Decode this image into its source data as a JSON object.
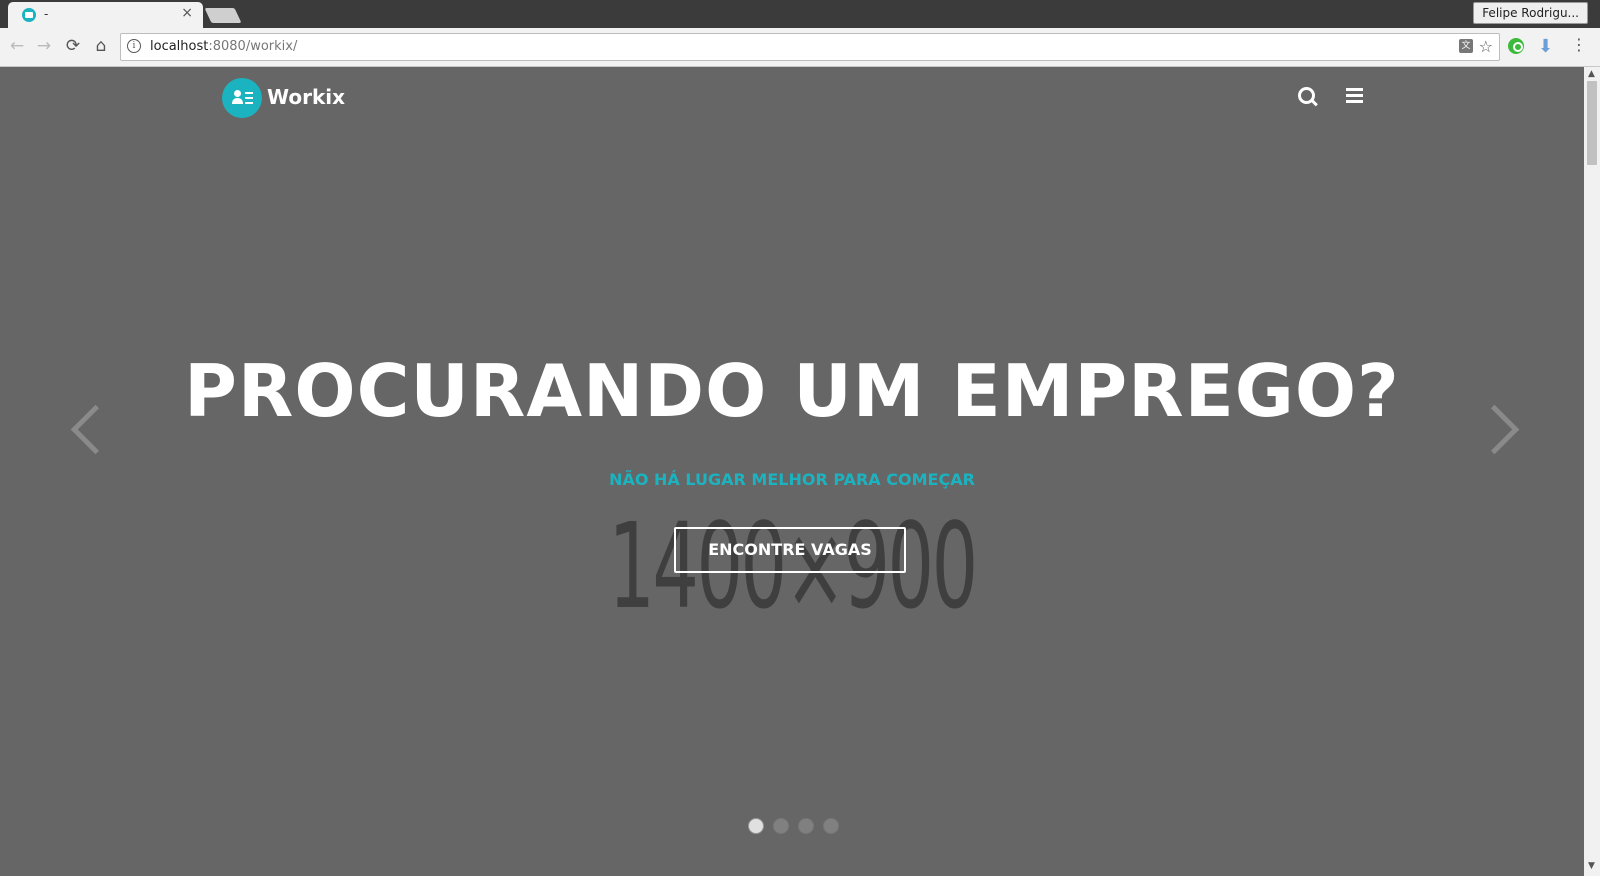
{
  "browser": {
    "tab_title": "-",
    "tab_close": "×",
    "profile_name": "Felipe Rodrigu...",
    "url_host": "localhost",
    "url_rest": ":8080/workix/",
    "back": "←",
    "forward": "→",
    "reload": "⟳",
    "home": "⌂",
    "star": "☆",
    "menu": "⋮",
    "download": "⬇",
    "info": "i",
    "translate": "文"
  },
  "site": {
    "brand": "Workix",
    "headline": "PROCURANDO UM EMPREGO?",
    "subtitle": "NÃO HÁ LUGAR MELHOR PARA COMEÇAR",
    "cta_label": "ENCONTRE VAGAS",
    "placeholder_text": "1400×900",
    "carousel": {
      "slide_count": 4,
      "active_index": 0
    }
  },
  "colors": {
    "accent": "#1bb3c0",
    "hero_bg": "#666666"
  }
}
